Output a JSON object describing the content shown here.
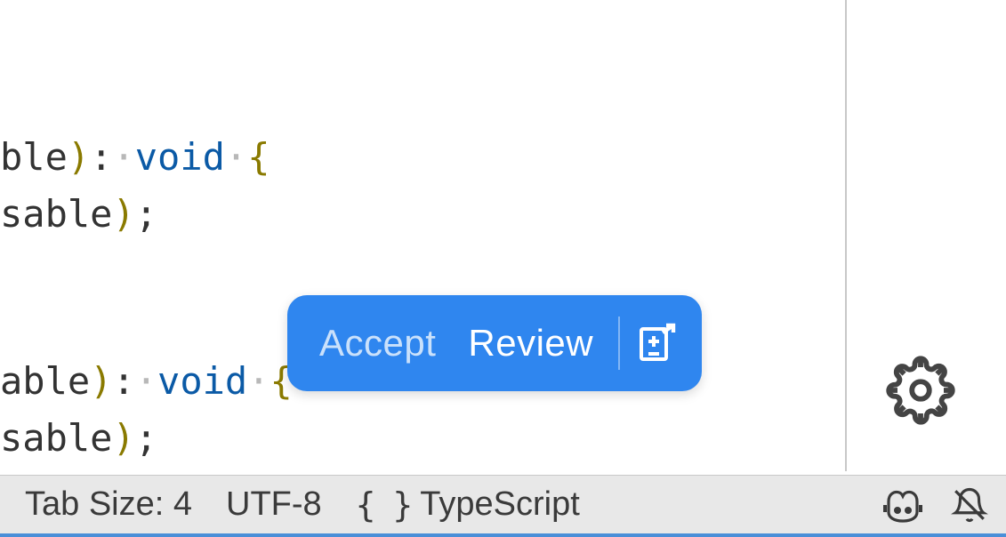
{
  "code": {
    "line1_ident": "ble",
    "line1_paren": ")",
    "line1_colon": ":",
    "line1_ws": "·",
    "line1_kw": "void",
    "line1_ws2": "·",
    "line1_brace": "{",
    "line2_ident": "sable",
    "line2_paren": ")",
    "line2_semi": ";",
    "line3_ident": "able",
    "line3_paren": ")",
    "line3_colon": ":",
    "line3_ws": "·",
    "line3_kw": "void",
    "line3_ws2": "·",
    "line3_brace": "{",
    "line4_ident": "sable",
    "line4_paren": ")",
    "line4_semi": ";"
  },
  "suggestion": {
    "accept": "Accept",
    "review": "Review"
  },
  "statusbar": {
    "tabsize": "Tab Size: 4",
    "encoding": "UTF-8",
    "language": "TypeScript"
  }
}
